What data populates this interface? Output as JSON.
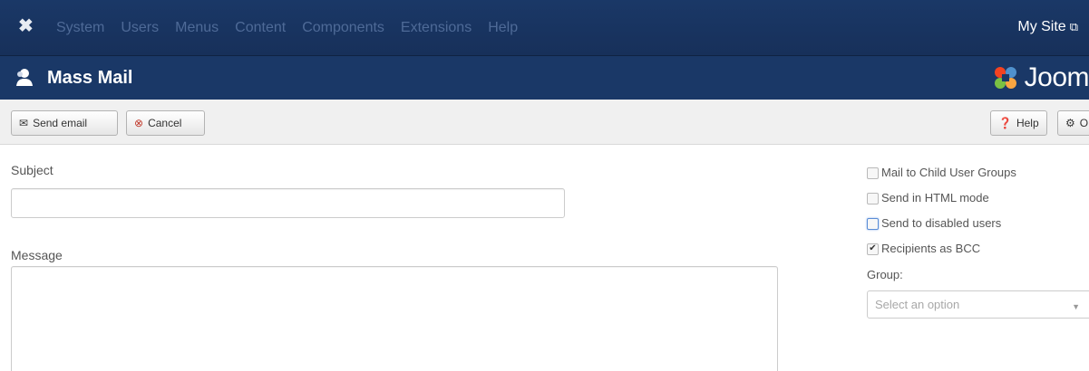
{
  "topnav": {
    "logo_icon": "joomla-icon",
    "menu": [
      "System",
      "Users",
      "Menus",
      "Content",
      "Components",
      "Extensions",
      "Help"
    ],
    "site_link": "My Site",
    "site_link_icon": "external-link-icon",
    "colors": {
      "bar": "#1a3867",
      "menu_text": "#4e6a97"
    }
  },
  "titlebar": {
    "icon": "users-icon",
    "title": "Mass Mail",
    "brand_text": "Joom"
  },
  "toolbar": {
    "send_label": "Send email",
    "cancel_label": "Cancel",
    "help_label": "Help",
    "options_label": "O"
  },
  "form": {
    "subject_label": "Subject",
    "subject_value": "",
    "message_label": "Message",
    "message_value": ""
  },
  "options": {
    "mail_child_groups": {
      "label": "Mail to Child User Groups",
      "checked": false
    },
    "html_mode": {
      "label": "Send in HTML mode",
      "checked": false
    },
    "disabled_users": {
      "label": "Send to disabled users",
      "checked": false
    },
    "bcc": {
      "label": "Recipients as BCC",
      "checked": true
    },
    "group_label": "Group:",
    "group_placeholder": "Select an option"
  }
}
